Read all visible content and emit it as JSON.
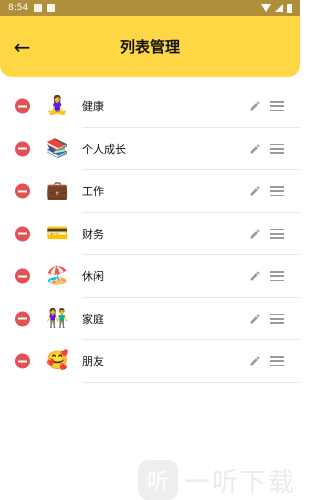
{
  "status_bar": {
    "time": "8:54"
  },
  "app_bar": {
    "title": "列表管理",
    "back_icon": "←"
  },
  "items": [
    {
      "emoji": "🧘‍♀️",
      "label": "健康"
    },
    {
      "emoji": "📚",
      "label": "个人成长"
    },
    {
      "emoji": "💼",
      "label": "工作"
    },
    {
      "emoji": "💳",
      "label": "财务"
    },
    {
      "emoji": "🏖️",
      "label": "休闲"
    },
    {
      "emoji": "👫",
      "label": "家庭"
    },
    {
      "emoji": "🥰",
      "label": "朋友"
    }
  ],
  "watermark": {
    "text": "一听下载",
    "logo": "听"
  },
  "colors": {
    "accent": "#ffd745",
    "remove": "#e35157",
    "statusbar": "#b08f3c"
  }
}
